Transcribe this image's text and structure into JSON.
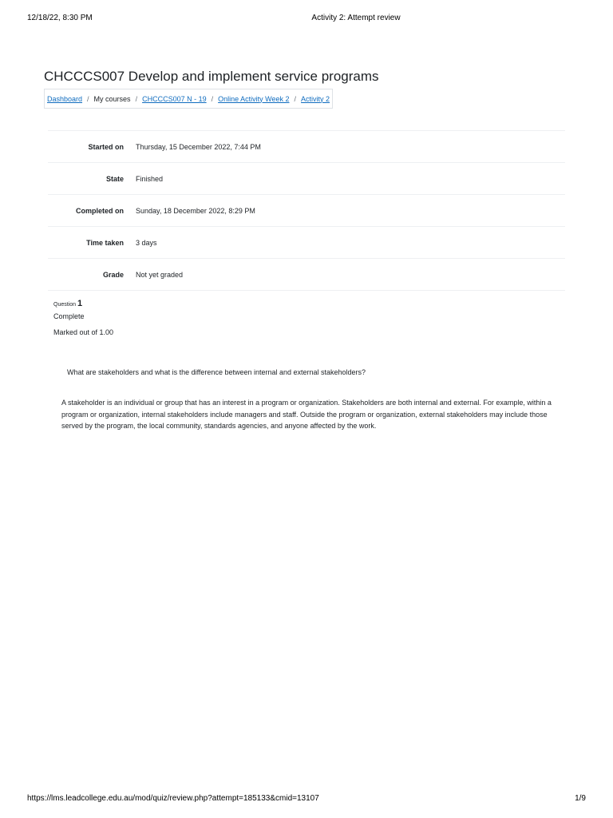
{
  "print_header": {
    "datetime": "12/18/22, 8:30 PM",
    "title": "Activity 2: Attempt review"
  },
  "page": {
    "title": "CHCCCS007 Develop and implement service programs"
  },
  "breadcrumb": {
    "items": [
      {
        "label": "Dashboard",
        "link": true
      },
      {
        "label": "My courses",
        "link": false
      },
      {
        "label": "CHCCCS007 N - 19",
        "link": true
      },
      {
        "label": "Online Activity Week 2",
        "link": true
      },
      {
        "label": "Activity 2",
        "link": true
      }
    ]
  },
  "summary": {
    "rows": [
      {
        "label": "Started on",
        "value": "Thursday, 15 December 2022, 7:44 PM"
      },
      {
        "label": "State",
        "value": "Finished"
      },
      {
        "label": "Completed on",
        "value": "Sunday, 18 December 2022, 8:29 PM"
      },
      {
        "label": "Time taken",
        "value": "3 days"
      },
      {
        "label": "Grade",
        "value": "Not yet graded"
      }
    ]
  },
  "question": {
    "label": "Question",
    "number": "1",
    "state": "Complete",
    "grade": "Marked out of 1.00",
    "text": "What are stakeholders and what is the difference between internal and external stakeholders?",
    "answer": "A stakeholder is an individual or group that has an interest in a program or organization. Stakeholders are both internal and external. For example, within a program or organization, internal stakeholders include managers and staff. Outside the program or organization, external stakeholders may include those served by the program, the local community, standards agencies, and anyone affected by the work."
  },
  "print_footer": {
    "url": "https://lms.leadcollege.edu.au/mod/quiz/review.php?attempt=185133&cmid=13107",
    "page": "1/9"
  }
}
